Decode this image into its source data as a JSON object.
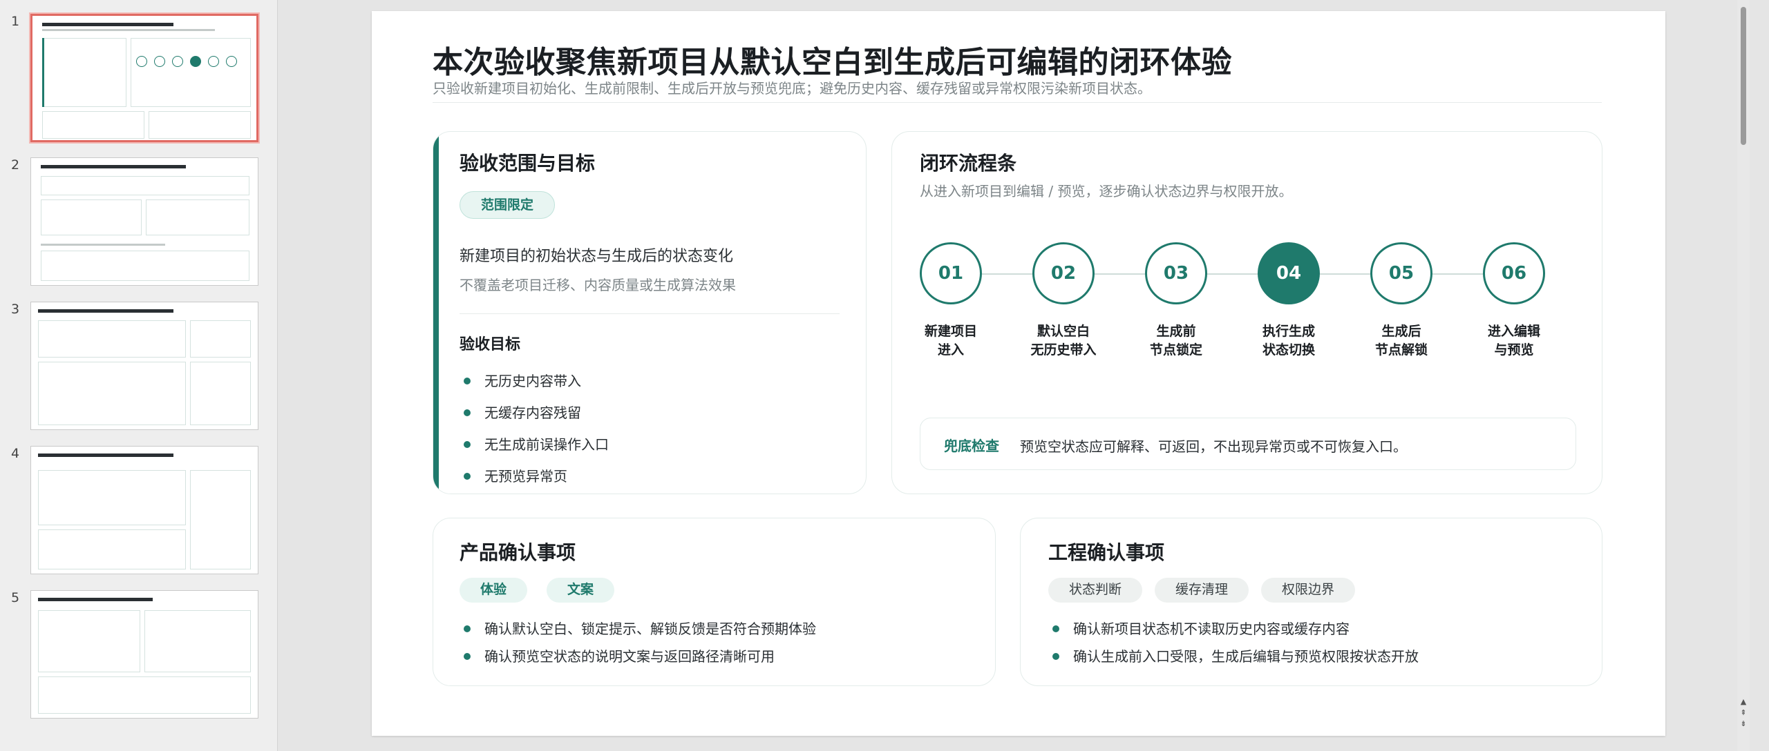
{
  "thumbnails": [
    {
      "number": "1",
      "selected": true
    },
    {
      "number": "2",
      "selected": false
    },
    {
      "number": "3",
      "selected": false
    },
    {
      "number": "4",
      "selected": false
    },
    {
      "number": "5",
      "selected": false
    }
  ],
  "slide": {
    "title": "本次验收聚焦新项目从默认空白到生成后可编辑的闭环体验",
    "subtitle": "只验收新建项目初始化、生成前限制、生成后开放与预览兜底；避免历史内容、缓存残留或异常权限污染新项目状态。",
    "scope": {
      "title": "验收范围与目标",
      "pill": "范围限定",
      "main": "新建项目的初始状态与生成后的状态变化",
      "note": "不覆盖老项目迁移、内容质量或生成算法效果",
      "goals_title": "验收目标",
      "goals": [
        "无历史内容带入",
        "无缓存内容残留",
        "无生成前误操作入口",
        "无预览异常页"
      ]
    },
    "flow": {
      "title": "闭环流程条",
      "subtitle": "从进入新项目到编辑 / 预览，逐步确认状态边界与权限开放。",
      "steps": [
        {
          "num": "01",
          "line1": "新建项目",
          "line2": "进入"
        },
        {
          "num": "02",
          "line1": "默认空白",
          "line2": "无历史带入"
        },
        {
          "num": "03",
          "line1": "生成前",
          "line2": "节点锁定"
        },
        {
          "num": "04",
          "line1": "执行生成",
          "line2": "状态切换",
          "active": true
        },
        {
          "num": "05",
          "line1": "生成后",
          "line2": "节点解锁"
        },
        {
          "num": "06",
          "line1": "进入编辑",
          "line2": "与预览"
        }
      ],
      "fallback_label": "兜底检查",
      "fallback_text": "预览空状态应可解释、可返回，不出现异常页或不可恢复入口。"
    },
    "product": {
      "title": "产品确认事项",
      "tags": [
        "体验",
        "文案"
      ],
      "items": [
        "确认默认空白、锁定提示、解锁反馈是否符合预期体验",
        "确认预览空状态的说明文案与返回路径清晰可用"
      ]
    },
    "engineering": {
      "title": "工程确认事项",
      "tags": [
        "状态判断",
        "缓存清理",
        "权限边界"
      ],
      "items": [
        "确认新项目状态机不读取历史内容或缓存内容",
        "确认生成前入口受限，生成后编辑与预览权限按状态开放"
      ]
    }
  },
  "colors": {
    "accent": "#1f7a6c",
    "selected_border": "#e06a63"
  }
}
